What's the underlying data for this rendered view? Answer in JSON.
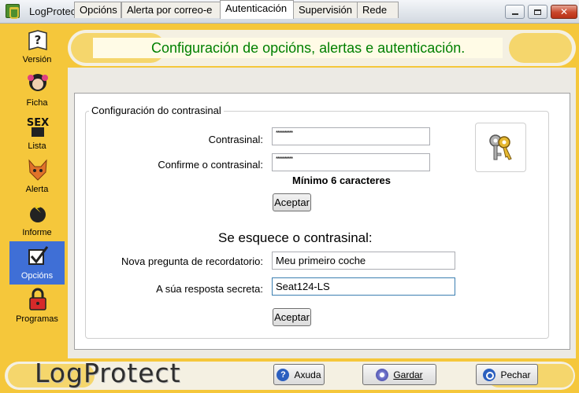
{
  "window": {
    "title": "LogProtect",
    "controls": {
      "minimize": "minimize-icon",
      "maximize": "maximize-icon",
      "close": "close-icon"
    }
  },
  "sidebar": {
    "items": [
      {
        "label": "Versión",
        "icon": "help-book-icon"
      },
      {
        "label": "Ficha",
        "icon": "profile-face-icon"
      },
      {
        "label": "Lista",
        "icon": "sex-list-icon"
      },
      {
        "label": "Alerta",
        "icon": "alert-fox-icon"
      },
      {
        "label": "Informe",
        "icon": "report-bomb-icon"
      },
      {
        "label": "Opcións",
        "icon": "checkbox-icon",
        "active": true
      },
      {
        "label": "Programas",
        "icon": "padlock-icon"
      }
    ]
  },
  "header": {
    "title": "Configuración de opcións, alertas e autenticación."
  },
  "tabs": [
    {
      "label": "Opcións"
    },
    {
      "label": "Alerta por correo-e"
    },
    {
      "label": "Autenticación",
      "active": true
    },
    {
      "label": "Supervisión"
    },
    {
      "label": "Rede"
    }
  ],
  "password_group": {
    "legend": "Configuración do contrasinal",
    "password_label": "Contrasinal:",
    "password_value": "**********",
    "confirm_label": "Confirme o contrasinal:",
    "confirm_value": "**********",
    "hint": "Mínimo 6 caracteres",
    "accept_label": "Aceptar",
    "key_icon": "keys-icon"
  },
  "forgot_section": {
    "title": "Se esquece o contrasinal:",
    "question_label": "Nova pregunta de recordatorio:",
    "question_value": "Meu primeiro coche",
    "answer_label": "A súa resposta secreta:",
    "answer_value": "Seat124-LS",
    "accept_label": "Aceptar"
  },
  "footer": {
    "logo": "LogProtect",
    "help_label": "Axuda",
    "save_label": "Gardar",
    "close_label": "Pechar"
  },
  "colors": {
    "sidebar": "#f5c73b",
    "title_green": "#008000",
    "active_item": "#3f6fd6"
  }
}
